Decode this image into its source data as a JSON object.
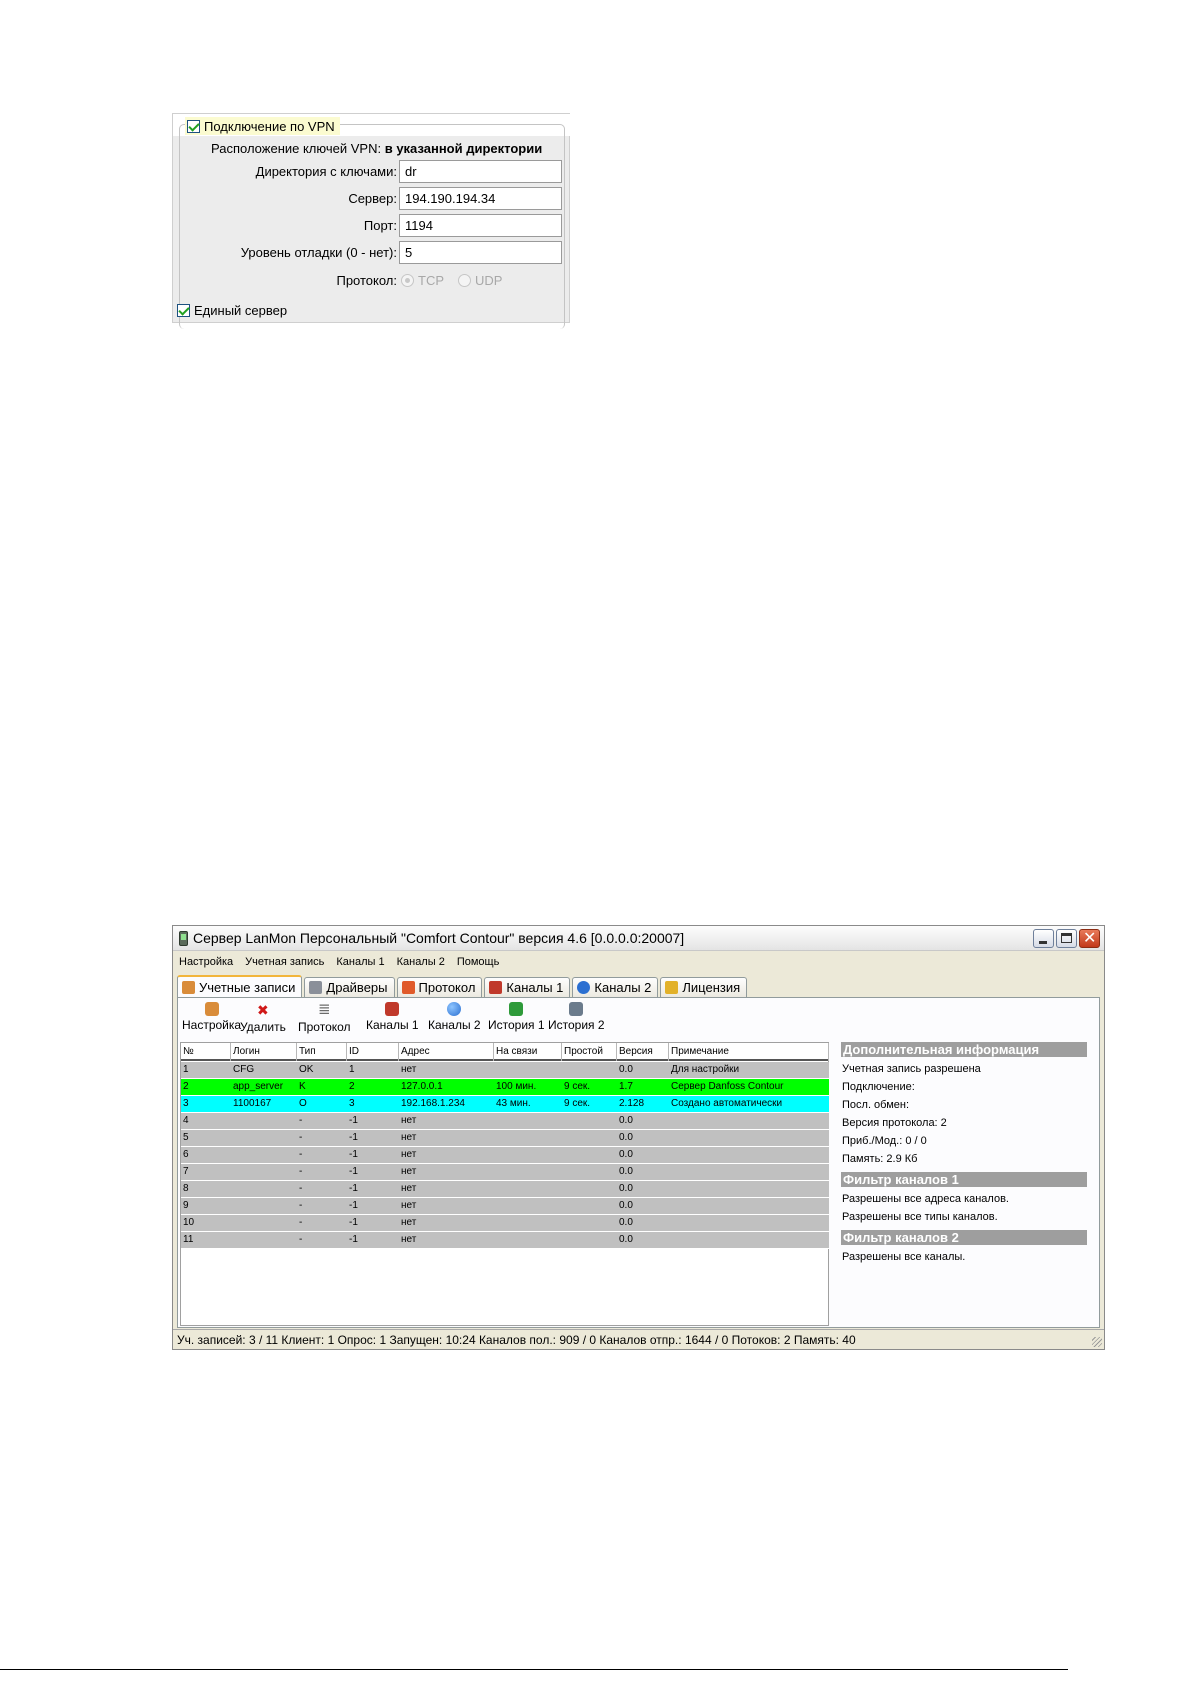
{
  "vpn": {
    "title": "Подключение по VPN",
    "key_location_label": "Расположение ключей VPN:",
    "key_location_value": "в указанной директории",
    "fields": [
      {
        "label": "Директория с ключами:",
        "value": "dr"
      },
      {
        "label": "Сервер:",
        "value": "194.190.194.34"
      },
      {
        "label": "Порт:",
        "value": "1194"
      },
      {
        "label": "Уровень отладки (0 - нет):",
        "value": "5"
      }
    ],
    "protocol_label": "Протокол:",
    "protocol_options": [
      "TCP",
      "UDP"
    ],
    "protocol_selected": "TCP",
    "single_server_label": "Единый сервер",
    "vpn_checked": true,
    "single_server_checked": true
  },
  "window": {
    "title": "Сервер LanMon Персональный \"Comfort Contour\" версия 4.6 [0.0.0.0:20007]",
    "menu": [
      "Настройка",
      "Учетная запись",
      "Каналы 1",
      "Каналы 2",
      "Помощь"
    ],
    "tabs": [
      {
        "label": "Учетные записи",
        "icon": "users-icon",
        "color": "#d98c3a"
      },
      {
        "label": "Драйверы",
        "icon": "drivers-icon",
        "color": "#8a8f99"
      },
      {
        "label": "Протокол",
        "icon": "protocol-icon",
        "color": "#e05a2a"
      },
      {
        "label": "Каналы 1",
        "icon": "network-icon",
        "color": "#c0392b"
      },
      {
        "label": "Каналы 2",
        "icon": "globe-icon",
        "color": "#2b6fd1"
      },
      {
        "label": "Лицензия",
        "icon": "lock-icon",
        "color": "#e2b12a"
      }
    ],
    "active_tab": "Учетные записи",
    "toolbar": [
      {
        "label": "Настройка",
        "icon": "user-settings-icon"
      },
      {
        "label": "Удалить",
        "icon": "delete-icon"
      },
      {
        "label": "Протокол",
        "icon": "log-icon"
      },
      {
        "label": "Каналы 1",
        "icon": "network-icon"
      },
      {
        "label": "Каналы 2",
        "icon": "globe-icon"
      },
      {
        "label": "История 1",
        "icon": "history-icon"
      },
      {
        "label": "История 2",
        "icon": "history-edit-icon"
      }
    ],
    "grid": {
      "columns": [
        "№",
        "Логин",
        "Тип",
        "ID",
        "Адрес",
        "На связи",
        "Простой",
        "Версия",
        "Примечание"
      ],
      "rows": [
        {
          "cells": [
            "1",
            "CFG",
            "OK",
            "1",
            "нет",
            "",
            "",
            "0.0",
            "Для настройки"
          ],
          "bg": "#c0c0c0"
        },
        {
          "cells": [
            "2",
            "app_server",
            "K",
            "2",
            "127.0.0.1",
            "100 мин.",
            "9 сек.",
            "1.7",
            "Сервер Danfoss Contour"
          ],
          "bg": "#00ff00"
        },
        {
          "cells": [
            "3",
            "1100167",
            "O",
            "3",
            "192.168.1.234",
            "43 мин.",
            "9 сек.",
            "2.128",
            "Создано автоматически"
          ],
          "bg": "#00ffff"
        },
        {
          "cells": [
            "4",
            "",
            "-",
            "-1",
            "нет",
            "",
            "",
            "0.0",
            ""
          ],
          "bg": "#c0c0c0"
        },
        {
          "cells": [
            "5",
            "",
            "-",
            "-1",
            "нет",
            "",
            "",
            "0.0",
            ""
          ],
          "bg": "#c0c0c0"
        },
        {
          "cells": [
            "6",
            "",
            "-",
            "-1",
            "нет",
            "",
            "",
            "0.0",
            ""
          ],
          "bg": "#c0c0c0"
        },
        {
          "cells": [
            "7",
            "",
            "-",
            "-1",
            "нет",
            "",
            "",
            "0.0",
            ""
          ],
          "bg": "#c0c0c0"
        },
        {
          "cells": [
            "8",
            "",
            "-",
            "-1",
            "нет",
            "",
            "",
            "0.0",
            ""
          ],
          "bg": "#c0c0c0"
        },
        {
          "cells": [
            "9",
            "",
            "-",
            "-1",
            "нет",
            "",
            "",
            "0.0",
            ""
          ],
          "bg": "#c0c0c0"
        },
        {
          "cells": [
            "10",
            "",
            "-",
            "-1",
            "нет",
            "",
            "",
            "0.0",
            ""
          ],
          "bg": "#c0c0c0"
        },
        {
          "cells": [
            "11",
            "",
            "-",
            "-1",
            "нет",
            "",
            "",
            "0.0",
            ""
          ],
          "bg": "#c0c0c0"
        }
      ]
    },
    "side": {
      "info_title": "Дополнительная информация",
      "info_lines": [
        "Учетная запись разрешена",
        "Подключение:",
        "Посл. обмен:",
        "Версия протокола: 2",
        "Приб./Мод.: 0 / 0",
        "Память: 2.9 Кб"
      ],
      "filter1_title": "Фильтр каналов 1",
      "filter1_lines": [
        "Разрешены все адреса каналов.",
        "Разрешены все типы каналов."
      ],
      "filter2_title": "Фильтр каналов 2",
      "filter2_lines": [
        "Разрешены все каналы."
      ]
    },
    "status": "Уч. записей: 3 / 11  Клиент: 1  Опрос: 1  Запущен: 10:24  Каналов пол.: 909 / 0 Каналов отпр.: 1644 / 0  Потоков: 2  Память: 40"
  }
}
